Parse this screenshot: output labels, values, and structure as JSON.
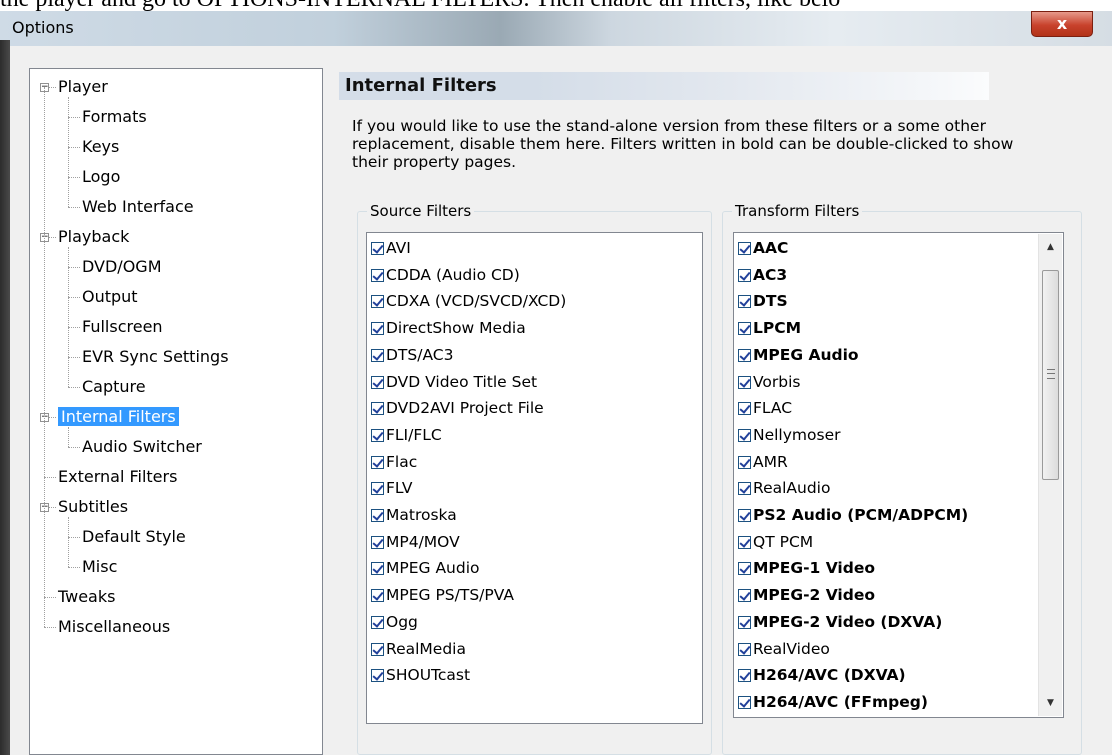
{
  "caption_text": "the player and go to OPTIONS-INTERNAL FILTERS. Then enable all filters, like belo",
  "window": {
    "title": "Options",
    "close_glyph": "x"
  },
  "tree": [
    {
      "label": "Player",
      "expander": "minus",
      "children": [
        "Formats",
        "Keys",
        "Logo",
        "Web Interface"
      ]
    },
    {
      "label": "Playback",
      "expander": "minus",
      "children": [
        "DVD/OGM",
        "Output",
        "Fullscreen",
        "EVR Sync Settings",
        "Capture"
      ]
    },
    {
      "label": "Internal Filters",
      "expander": "minus",
      "selected": true,
      "children": [
        "Audio Switcher"
      ]
    },
    {
      "label": "External Filters",
      "expander": null,
      "children": []
    },
    {
      "label": "Subtitles",
      "expander": "minus",
      "children": [
        "Default Style",
        "Misc"
      ]
    },
    {
      "label": "Tweaks",
      "expander": null,
      "children": []
    },
    {
      "label": "Miscellaneous",
      "expander": null,
      "children": []
    }
  ],
  "page": {
    "title": "Internal Filters",
    "description_lines": [
      "If you would like to use the stand-alone version from these filters or a some other",
      "replacement, disable them here. Filters written in bold can be double-clicked to show",
      "their property pages."
    ]
  },
  "source_filters": {
    "label": "Source Filters",
    "items": [
      {
        "label": "AVI",
        "checked": true,
        "bold": false
      },
      {
        "label": "CDDA (Audio CD)",
        "checked": true,
        "bold": false
      },
      {
        "label": "CDXA (VCD/SVCD/XCD)",
        "checked": true,
        "bold": false
      },
      {
        "label": "DirectShow Media",
        "checked": true,
        "bold": false
      },
      {
        "label": "DTS/AC3",
        "checked": true,
        "bold": false
      },
      {
        "label": "DVD Video Title Set",
        "checked": true,
        "bold": false
      },
      {
        "label": "DVD2AVI Project File",
        "checked": true,
        "bold": false
      },
      {
        "label": "FLI/FLC",
        "checked": true,
        "bold": false
      },
      {
        "label": "Flac",
        "checked": true,
        "bold": false
      },
      {
        "label": "FLV",
        "checked": true,
        "bold": false
      },
      {
        "label": "Matroska",
        "checked": true,
        "bold": false
      },
      {
        "label": "MP4/MOV",
        "checked": true,
        "bold": false
      },
      {
        "label": "MPEG Audio",
        "checked": true,
        "bold": false
      },
      {
        "label": "MPEG PS/TS/PVA",
        "checked": true,
        "bold": false
      },
      {
        "label": "Ogg",
        "checked": true,
        "bold": false
      },
      {
        "label": "RealMedia",
        "checked": true,
        "bold": false
      },
      {
        "label": "SHOUTcast",
        "checked": true,
        "bold": false
      }
    ]
  },
  "transform_filters": {
    "label": "Transform Filters",
    "items": [
      {
        "label": "AAC",
        "checked": true,
        "bold": true
      },
      {
        "label": "AC3",
        "checked": true,
        "bold": true
      },
      {
        "label": "DTS",
        "checked": true,
        "bold": true
      },
      {
        "label": "LPCM",
        "checked": true,
        "bold": true
      },
      {
        "label": "MPEG Audio",
        "checked": true,
        "bold": true
      },
      {
        "label": "Vorbis",
        "checked": true,
        "bold": false
      },
      {
        "label": "FLAC",
        "checked": true,
        "bold": false
      },
      {
        "label": "Nellymoser",
        "checked": true,
        "bold": false
      },
      {
        "label": "AMR",
        "checked": true,
        "bold": false
      },
      {
        "label": "RealAudio",
        "checked": true,
        "bold": false
      },
      {
        "label": "PS2 Audio (PCM/ADPCM)",
        "checked": true,
        "bold": true
      },
      {
        "label": "QT PCM",
        "checked": true,
        "bold": false
      },
      {
        "label": "MPEG-1 Video",
        "checked": true,
        "bold": true
      },
      {
        "label": "MPEG-2 Video",
        "checked": true,
        "bold": true
      },
      {
        "label": "MPEG-2 Video (DXVA)",
        "checked": true,
        "bold": true
      },
      {
        "label": "RealVideo",
        "checked": true,
        "bold": false
      },
      {
        "label": "H264/AVC (DXVA)",
        "checked": true,
        "bold": true
      },
      {
        "label": "H264/AVC (FFmpeg)",
        "checked": true,
        "bold": true
      }
    ]
  },
  "icons": {
    "scroll_up": "triangle-up",
    "scroll_down": "triangle-down",
    "selection_color": "#3399ff"
  }
}
